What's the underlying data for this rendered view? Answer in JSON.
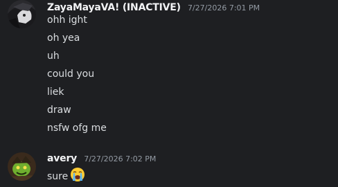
{
  "messages": [
    {
      "username": "ZayaMayaVA! (INACTIVE)",
      "timestamp": "7/27/2026 7:01 PM",
      "avatar_icon": "dark-anime-avatar",
      "lines": [
        "ohh ight",
        "oh yea",
        "uh",
        "could you",
        "liek",
        "draw",
        "nsfw ofg me"
      ]
    },
    {
      "username": "avery",
      "timestamp": "7/27/2026 7:02 PM",
      "avatar_icon": "green-goblin-avatar",
      "lines": [
        "sure"
      ],
      "emoji": "loudly-crying-face-icon"
    }
  ],
  "colors": {
    "background": "#1e1f22",
    "username": "#f2f3f5",
    "text": "#dbdee1",
    "timestamp": "#949ba4"
  }
}
